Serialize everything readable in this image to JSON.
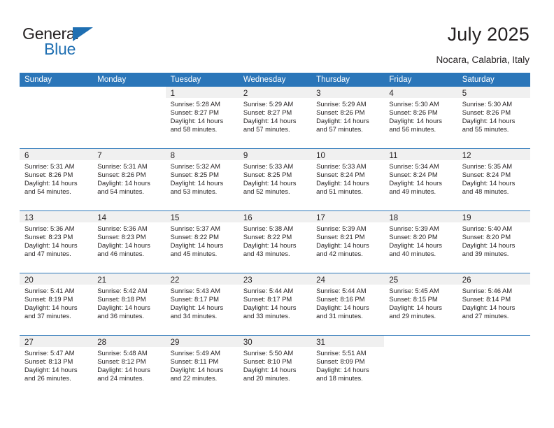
{
  "brand": {
    "name_top": "General",
    "name_bottom": "Blue",
    "triangle_color": "#1f6fb2"
  },
  "header": {
    "title": "July 2025",
    "subtitle": "Nocara, Calabria, Italy"
  },
  "theme": {
    "header_blue": "#2b76b9",
    "daynum_band": "#f0f0f0",
    "text": "#231f20"
  },
  "calendar": {
    "weekdays": [
      "Sunday",
      "Monday",
      "Tuesday",
      "Wednesday",
      "Thursday",
      "Friday",
      "Saturday"
    ],
    "weeks": [
      [
        {
          "day": "",
          "sunrise": "",
          "sunset": "",
          "daylight_line1": "",
          "daylight_line2": ""
        },
        {
          "day": "",
          "sunrise": "",
          "sunset": "",
          "daylight_line1": "",
          "daylight_line2": ""
        },
        {
          "day": "1",
          "sunrise": "Sunrise: 5:28 AM",
          "sunset": "Sunset: 8:27 PM",
          "daylight_line1": "Daylight: 14 hours",
          "daylight_line2": "and 58 minutes."
        },
        {
          "day": "2",
          "sunrise": "Sunrise: 5:29 AM",
          "sunset": "Sunset: 8:27 PM",
          "daylight_line1": "Daylight: 14 hours",
          "daylight_line2": "and 57 minutes."
        },
        {
          "day": "3",
          "sunrise": "Sunrise: 5:29 AM",
          "sunset": "Sunset: 8:26 PM",
          "daylight_line1": "Daylight: 14 hours",
          "daylight_line2": "and 57 minutes."
        },
        {
          "day": "4",
          "sunrise": "Sunrise: 5:30 AM",
          "sunset": "Sunset: 8:26 PM",
          "daylight_line1": "Daylight: 14 hours",
          "daylight_line2": "and 56 minutes."
        },
        {
          "day": "5",
          "sunrise": "Sunrise: 5:30 AM",
          "sunset": "Sunset: 8:26 PM",
          "daylight_line1": "Daylight: 14 hours",
          "daylight_line2": "and 55 minutes."
        }
      ],
      [
        {
          "day": "6",
          "sunrise": "Sunrise: 5:31 AM",
          "sunset": "Sunset: 8:26 PM",
          "daylight_line1": "Daylight: 14 hours",
          "daylight_line2": "and 54 minutes."
        },
        {
          "day": "7",
          "sunrise": "Sunrise: 5:31 AM",
          "sunset": "Sunset: 8:26 PM",
          "daylight_line1": "Daylight: 14 hours",
          "daylight_line2": "and 54 minutes."
        },
        {
          "day": "8",
          "sunrise": "Sunrise: 5:32 AM",
          "sunset": "Sunset: 8:25 PM",
          "daylight_line1": "Daylight: 14 hours",
          "daylight_line2": "and 53 minutes."
        },
        {
          "day": "9",
          "sunrise": "Sunrise: 5:33 AM",
          "sunset": "Sunset: 8:25 PM",
          "daylight_line1": "Daylight: 14 hours",
          "daylight_line2": "and 52 minutes."
        },
        {
          "day": "10",
          "sunrise": "Sunrise: 5:33 AM",
          "sunset": "Sunset: 8:24 PM",
          "daylight_line1": "Daylight: 14 hours",
          "daylight_line2": "and 51 minutes."
        },
        {
          "day": "11",
          "sunrise": "Sunrise: 5:34 AM",
          "sunset": "Sunset: 8:24 PM",
          "daylight_line1": "Daylight: 14 hours",
          "daylight_line2": "and 49 minutes."
        },
        {
          "day": "12",
          "sunrise": "Sunrise: 5:35 AM",
          "sunset": "Sunset: 8:24 PM",
          "daylight_line1": "Daylight: 14 hours",
          "daylight_line2": "and 48 minutes."
        }
      ],
      [
        {
          "day": "13",
          "sunrise": "Sunrise: 5:36 AM",
          "sunset": "Sunset: 8:23 PM",
          "daylight_line1": "Daylight: 14 hours",
          "daylight_line2": "and 47 minutes."
        },
        {
          "day": "14",
          "sunrise": "Sunrise: 5:36 AM",
          "sunset": "Sunset: 8:23 PM",
          "daylight_line1": "Daylight: 14 hours",
          "daylight_line2": "and 46 minutes."
        },
        {
          "day": "15",
          "sunrise": "Sunrise: 5:37 AM",
          "sunset": "Sunset: 8:22 PM",
          "daylight_line1": "Daylight: 14 hours",
          "daylight_line2": "and 45 minutes."
        },
        {
          "day": "16",
          "sunrise": "Sunrise: 5:38 AM",
          "sunset": "Sunset: 8:22 PM",
          "daylight_line1": "Daylight: 14 hours",
          "daylight_line2": "and 43 minutes."
        },
        {
          "day": "17",
          "sunrise": "Sunrise: 5:39 AM",
          "sunset": "Sunset: 8:21 PM",
          "daylight_line1": "Daylight: 14 hours",
          "daylight_line2": "and 42 minutes."
        },
        {
          "day": "18",
          "sunrise": "Sunrise: 5:39 AM",
          "sunset": "Sunset: 8:20 PM",
          "daylight_line1": "Daylight: 14 hours",
          "daylight_line2": "and 40 minutes."
        },
        {
          "day": "19",
          "sunrise": "Sunrise: 5:40 AM",
          "sunset": "Sunset: 8:20 PM",
          "daylight_line1": "Daylight: 14 hours",
          "daylight_line2": "and 39 minutes."
        }
      ],
      [
        {
          "day": "20",
          "sunrise": "Sunrise: 5:41 AM",
          "sunset": "Sunset: 8:19 PM",
          "daylight_line1": "Daylight: 14 hours",
          "daylight_line2": "and 37 minutes."
        },
        {
          "day": "21",
          "sunrise": "Sunrise: 5:42 AM",
          "sunset": "Sunset: 8:18 PM",
          "daylight_line1": "Daylight: 14 hours",
          "daylight_line2": "and 36 minutes."
        },
        {
          "day": "22",
          "sunrise": "Sunrise: 5:43 AM",
          "sunset": "Sunset: 8:17 PM",
          "daylight_line1": "Daylight: 14 hours",
          "daylight_line2": "and 34 minutes."
        },
        {
          "day": "23",
          "sunrise": "Sunrise: 5:44 AM",
          "sunset": "Sunset: 8:17 PM",
          "daylight_line1": "Daylight: 14 hours",
          "daylight_line2": "and 33 minutes."
        },
        {
          "day": "24",
          "sunrise": "Sunrise: 5:44 AM",
          "sunset": "Sunset: 8:16 PM",
          "daylight_line1": "Daylight: 14 hours",
          "daylight_line2": "and 31 minutes."
        },
        {
          "day": "25",
          "sunrise": "Sunrise: 5:45 AM",
          "sunset": "Sunset: 8:15 PM",
          "daylight_line1": "Daylight: 14 hours",
          "daylight_line2": "and 29 minutes."
        },
        {
          "day": "26",
          "sunrise": "Sunrise: 5:46 AM",
          "sunset": "Sunset: 8:14 PM",
          "daylight_line1": "Daylight: 14 hours",
          "daylight_line2": "and 27 minutes."
        }
      ],
      [
        {
          "day": "27",
          "sunrise": "Sunrise: 5:47 AM",
          "sunset": "Sunset: 8:13 PM",
          "daylight_line1": "Daylight: 14 hours",
          "daylight_line2": "and 26 minutes."
        },
        {
          "day": "28",
          "sunrise": "Sunrise: 5:48 AM",
          "sunset": "Sunset: 8:12 PM",
          "daylight_line1": "Daylight: 14 hours",
          "daylight_line2": "and 24 minutes."
        },
        {
          "day": "29",
          "sunrise": "Sunrise: 5:49 AM",
          "sunset": "Sunset: 8:11 PM",
          "daylight_line1": "Daylight: 14 hours",
          "daylight_line2": "and 22 minutes."
        },
        {
          "day": "30",
          "sunrise": "Sunrise: 5:50 AM",
          "sunset": "Sunset: 8:10 PM",
          "daylight_line1": "Daylight: 14 hours",
          "daylight_line2": "and 20 minutes."
        },
        {
          "day": "31",
          "sunrise": "Sunrise: 5:51 AM",
          "sunset": "Sunset: 8:09 PM",
          "daylight_line1": "Daylight: 14 hours",
          "daylight_line2": "and 18 minutes."
        },
        {
          "day": "",
          "sunrise": "",
          "sunset": "",
          "daylight_line1": "",
          "daylight_line2": ""
        },
        {
          "day": "",
          "sunrise": "",
          "sunset": "",
          "daylight_line1": "",
          "daylight_line2": ""
        }
      ]
    ]
  }
}
